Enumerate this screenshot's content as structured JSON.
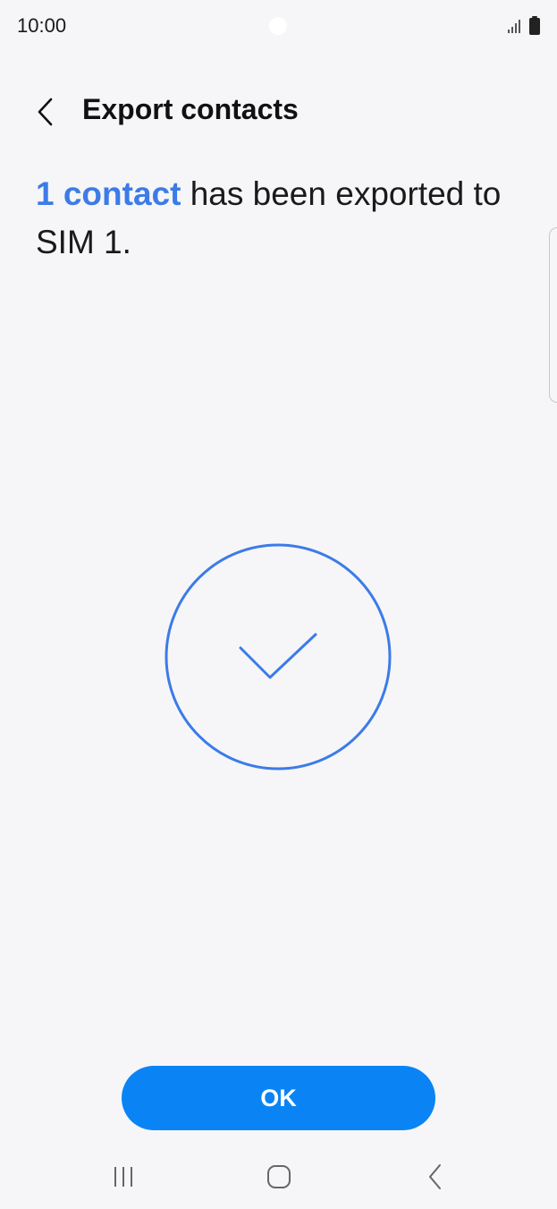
{
  "status_bar": {
    "time": "10:00",
    "icons": [
      "signal-icon",
      "battery-icon"
    ]
  },
  "header": {
    "title": "Export contacts",
    "back_icon": "chevron-left-icon"
  },
  "message": {
    "highlight": "1 contact",
    "text": " has been exported to SIM 1."
  },
  "success_icon": "check-circle-icon",
  "ok_button": {
    "label": "OK"
  },
  "nav_bar": {
    "icons": [
      "recent-apps-icon",
      "home-icon",
      "back-icon"
    ]
  },
  "colors": {
    "accent": "#3c7be8",
    "button": "#0a84f5",
    "background": "#f6f6f8"
  }
}
